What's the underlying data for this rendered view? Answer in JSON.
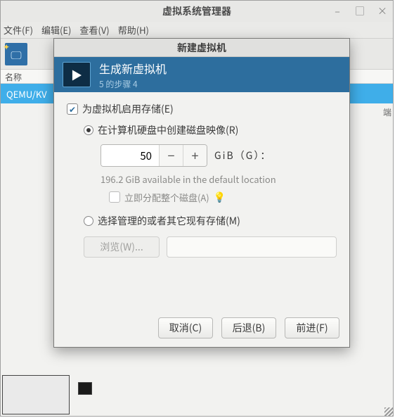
{
  "vmm": {
    "title": "虚拟系统管理器",
    "menu": {
      "file": "文件(F)",
      "edit": "编辑(E)",
      "view": "查看(V)",
      "help": "帮助(H)"
    },
    "column_name": "名称",
    "rows": [
      "QEMU/KV"
    ],
    "right_edge": "端"
  },
  "dialog": {
    "title": "新建虚拟机",
    "banner_title": "生成新虚拟机",
    "banner_step": "5 的步骤 4",
    "enable_storage": "为虚拟机启用存储(E)",
    "enable_storage_checked": true,
    "create_disk": "在计算机硬盘中创建磁盘映像(R)",
    "create_disk_selected": true,
    "disk_size_value": "50",
    "disk_size_unit": "GiB（G）：",
    "available_hint": "196.2 GiB available in the default location",
    "allocate_now": "立即分配整个磁盘(A)",
    "allocate_now_checked": false,
    "managed_storage": "选择管理的或者其它现有存储(M)",
    "managed_storage_selected": false,
    "browse_label": "浏览(W)...",
    "buttons": {
      "cancel": "取消(C)",
      "back": "后退(B)",
      "forward": "前进(F)"
    }
  },
  "icons": {
    "minimize": "–",
    "maximize": "□",
    "close": "×",
    "check": "✔",
    "play": "▶",
    "star": "✦",
    "bulb": "💡",
    "minus": "−",
    "plus": "+",
    "monitor": "🖵"
  }
}
